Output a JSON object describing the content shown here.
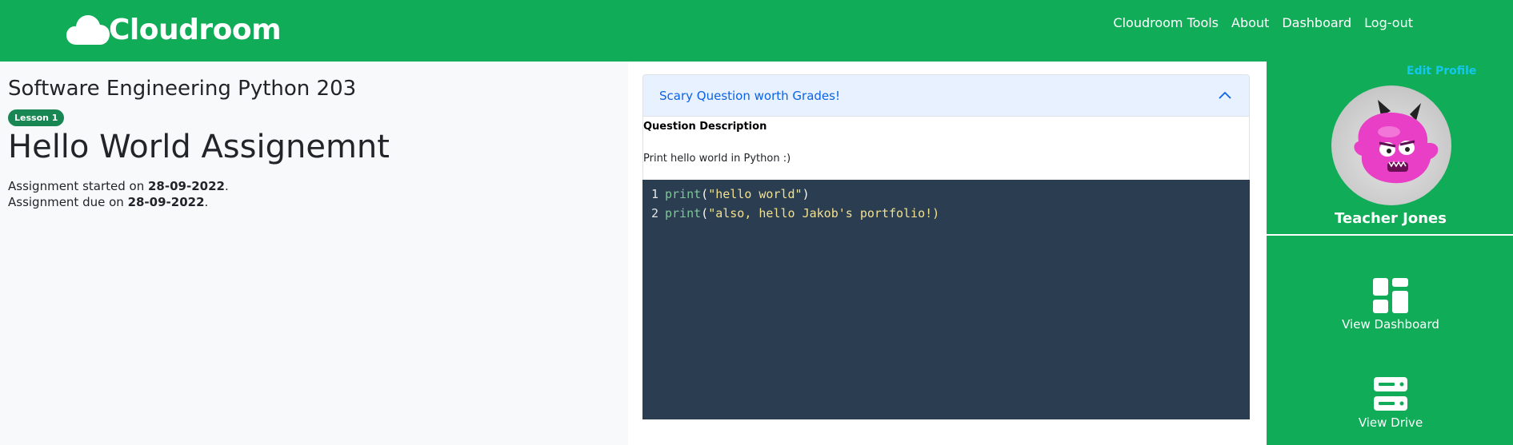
{
  "navbar": {
    "brand": "Cloudroom",
    "links": [
      "Cloudroom Tools",
      "About",
      "Dashboard",
      "Log-out"
    ]
  },
  "assignment": {
    "course": "Software Engineering Python 203",
    "lesson_badge": "Lesson 1",
    "title": "Hello World Assignemnt",
    "started_prefix": "Assignment started on ",
    "started_date": "28-09-2022",
    "due_prefix": "Assignment due on ",
    "due_date": "28-09-2022",
    "suffix": "."
  },
  "question": {
    "header": "Scary Question worth Grades!",
    "label": "Question Description",
    "text": "Print hello world in Python :)"
  },
  "code": {
    "lines": [
      {
        "num": "1",
        "keyword": "print",
        "open": "(",
        "string": "\"hello world\"",
        "close": ")"
      },
      {
        "num": "2",
        "keyword": "print",
        "open": "(",
        "string": "\"also, hello Jakob's portfolio!)",
        "close": ""
      }
    ]
  },
  "profile": {
    "edit_label": "Edit Profile",
    "name": "Teacher Jones",
    "actions": [
      {
        "label": "View Dashboard",
        "icon": "dashboard-icon"
      },
      {
        "label": "View Drive",
        "icon": "server-icon"
      }
    ]
  },
  "colors": {
    "brand_green": "#10ac57",
    "badge_green": "#198754",
    "accent_blue": "#0c63e4",
    "editor_bg": "#2b3d50",
    "edit_profile": "#14c7f0"
  }
}
